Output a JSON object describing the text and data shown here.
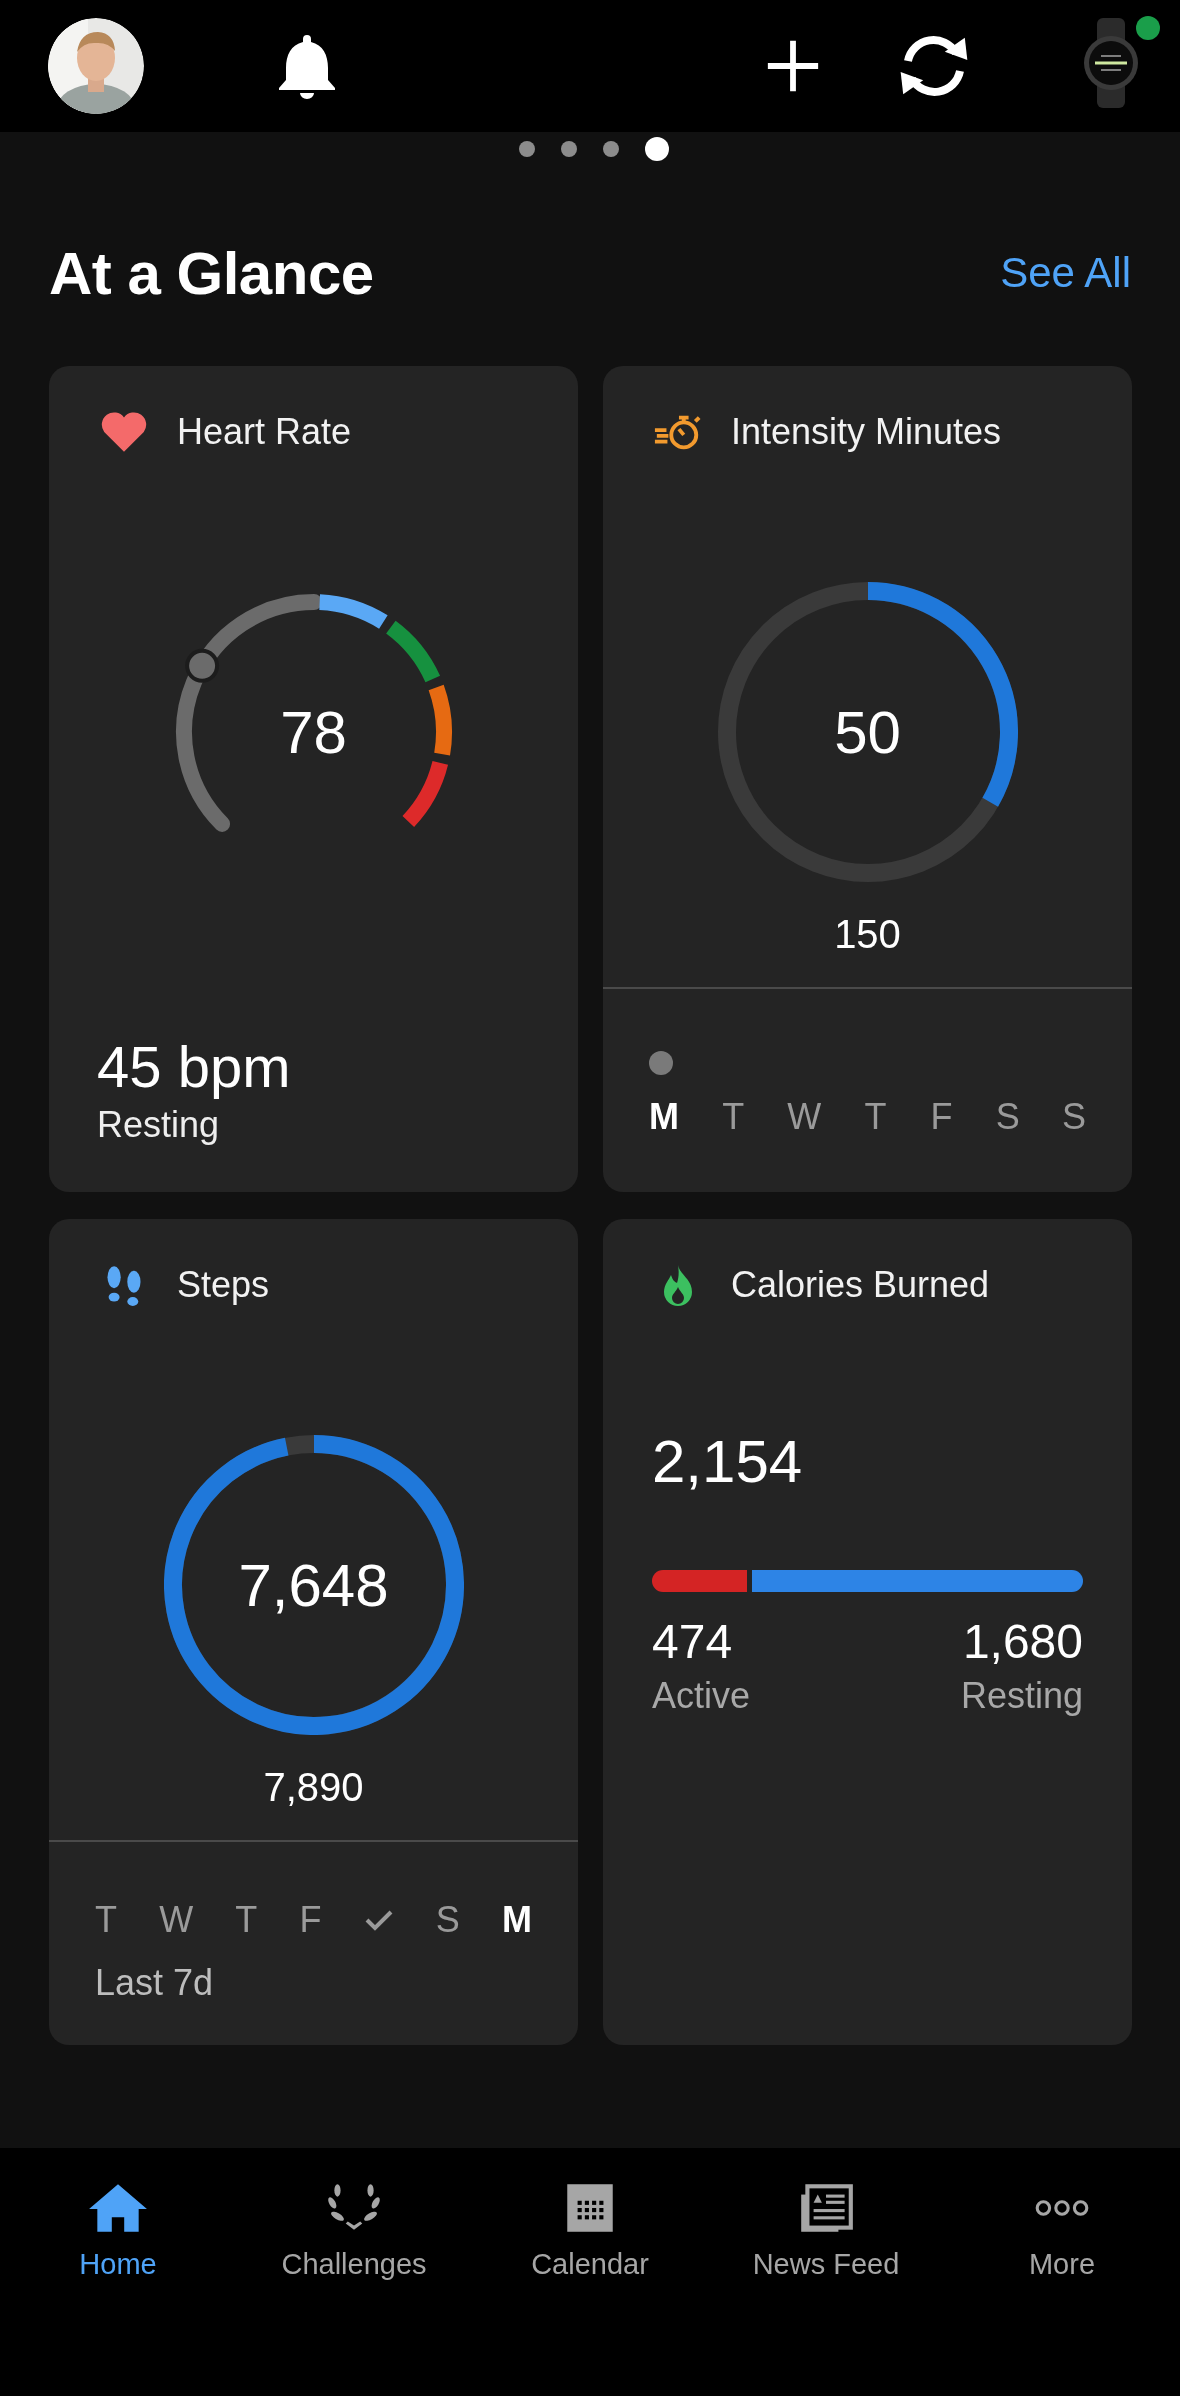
{
  "top_bar": {
    "device": {
      "connected": true
    }
  },
  "pager": [
    {
      "selected": false
    },
    {
      "selected": false
    },
    {
      "selected": false
    },
    {
      "selected": true
    }
  ],
  "section": {
    "title": "At a Glance",
    "link": "See All"
  },
  "heart_rate": {
    "title": "Heart Rate",
    "value": "78",
    "zones": [
      {
        "color": "#6b6b6b"
      },
      {
        "color": "#5aa8f5"
      },
      {
        "color": "#16913f"
      },
      {
        "color": "#e66a12"
      },
      {
        "color": "#dd2a2a"
      }
    ],
    "resting_value": "45 bpm",
    "resting_label": "Resting"
  },
  "intensity_minutes": {
    "title": "Intensity Minutes",
    "value": "50",
    "goal": "150",
    "days": [
      {
        "label": "M",
        "selected": true,
        "active": true
      },
      {
        "label": "T",
        "selected": false,
        "active": false
      },
      {
        "label": "W",
        "selected": false,
        "active": false
      },
      {
        "label": "T",
        "selected": false,
        "active": false
      },
      {
        "label": "F",
        "selected": false,
        "active": false
      },
      {
        "label": "S",
        "selected": false,
        "active": false
      },
      {
        "label": "S",
        "selected": false,
        "active": false
      }
    ]
  },
  "steps": {
    "title": "Steps",
    "value": "7,648",
    "goal": "7,890",
    "days": [
      {
        "kind": "letter",
        "label": "T",
        "selected": false
      },
      {
        "kind": "letter",
        "label": "W",
        "selected": false
      },
      {
        "kind": "letter",
        "label": "T",
        "selected": false
      },
      {
        "kind": "letter",
        "label": "F",
        "selected": false
      },
      {
        "kind": "check",
        "selected": false
      },
      {
        "kind": "letter",
        "label": "S",
        "selected": false
      },
      {
        "kind": "letter",
        "label": "M",
        "selected": true
      }
    ],
    "range": "Last 7d"
  },
  "calories": {
    "title": "Calories Burned",
    "total": "2,154",
    "level": 0.22,
    "active_value": "474",
    "active_label": "Active",
    "resting_value": "1,680",
    "resting_label": "Resting"
  },
  "tab_bar": [
    {
      "kind": "home",
      "label": "Home",
      "selected": true
    },
    {
      "kind": "laurel",
      "label": "Challenges",
      "selected": false
    },
    {
      "kind": "calendar",
      "label": "Calendar",
      "selected": false
    },
    {
      "kind": "news",
      "label": "News Feed",
      "selected": false
    },
    {
      "kind": "more",
      "label": "More",
      "selected": false
    }
  ]
}
